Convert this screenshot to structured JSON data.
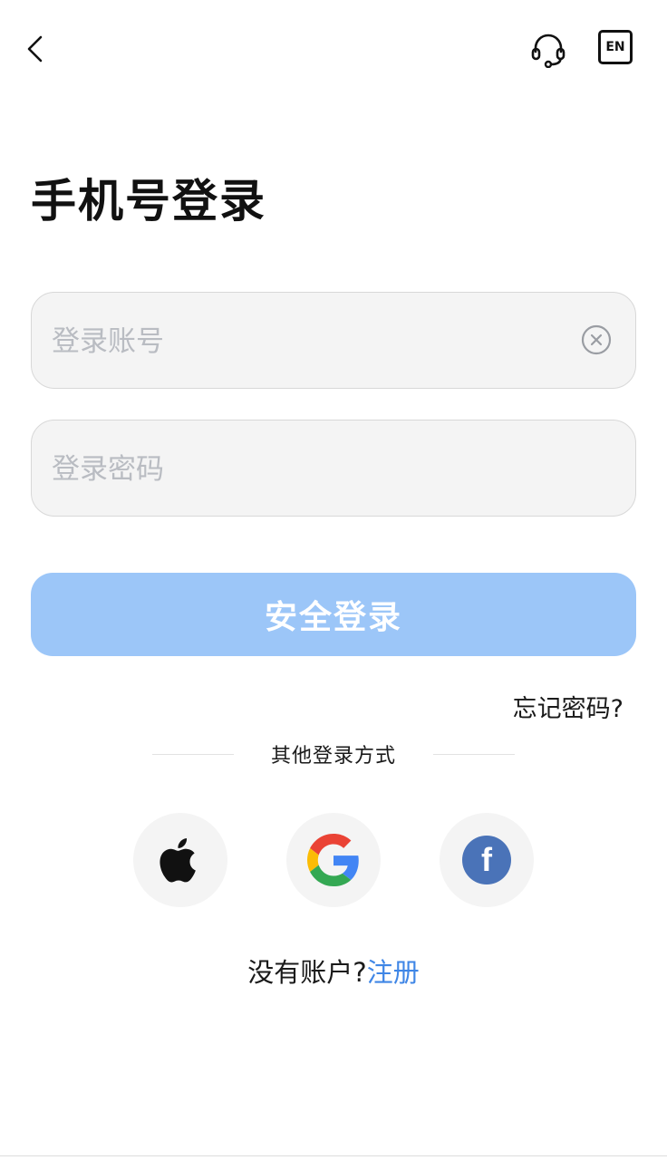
{
  "header": {
    "back_icon": "chevron-left-icon",
    "support_icon": "headset-icon",
    "language_label": "EN"
  },
  "title": "手机号登录",
  "form": {
    "account": {
      "value": "",
      "placeholder": "登录账号",
      "clear_icon": "clear-circle-icon"
    },
    "password": {
      "value": "",
      "placeholder": "登录密码"
    },
    "submit_label": "安全登录",
    "forgot_label": "忘记密码?"
  },
  "other_login": {
    "label": "其他登录方式",
    "providers": [
      {
        "icon": "apple-icon"
      },
      {
        "icon": "google-icon"
      },
      {
        "icon": "facebook-icon",
        "glyph": "f"
      }
    ]
  },
  "register": {
    "prompt": "没有账户?",
    "link_label": "注册"
  },
  "colors": {
    "primary_button": "#9cc6f8",
    "link": "#3f86e6",
    "field_background": "#f4f4f4",
    "facebook": "#4a73b8"
  }
}
